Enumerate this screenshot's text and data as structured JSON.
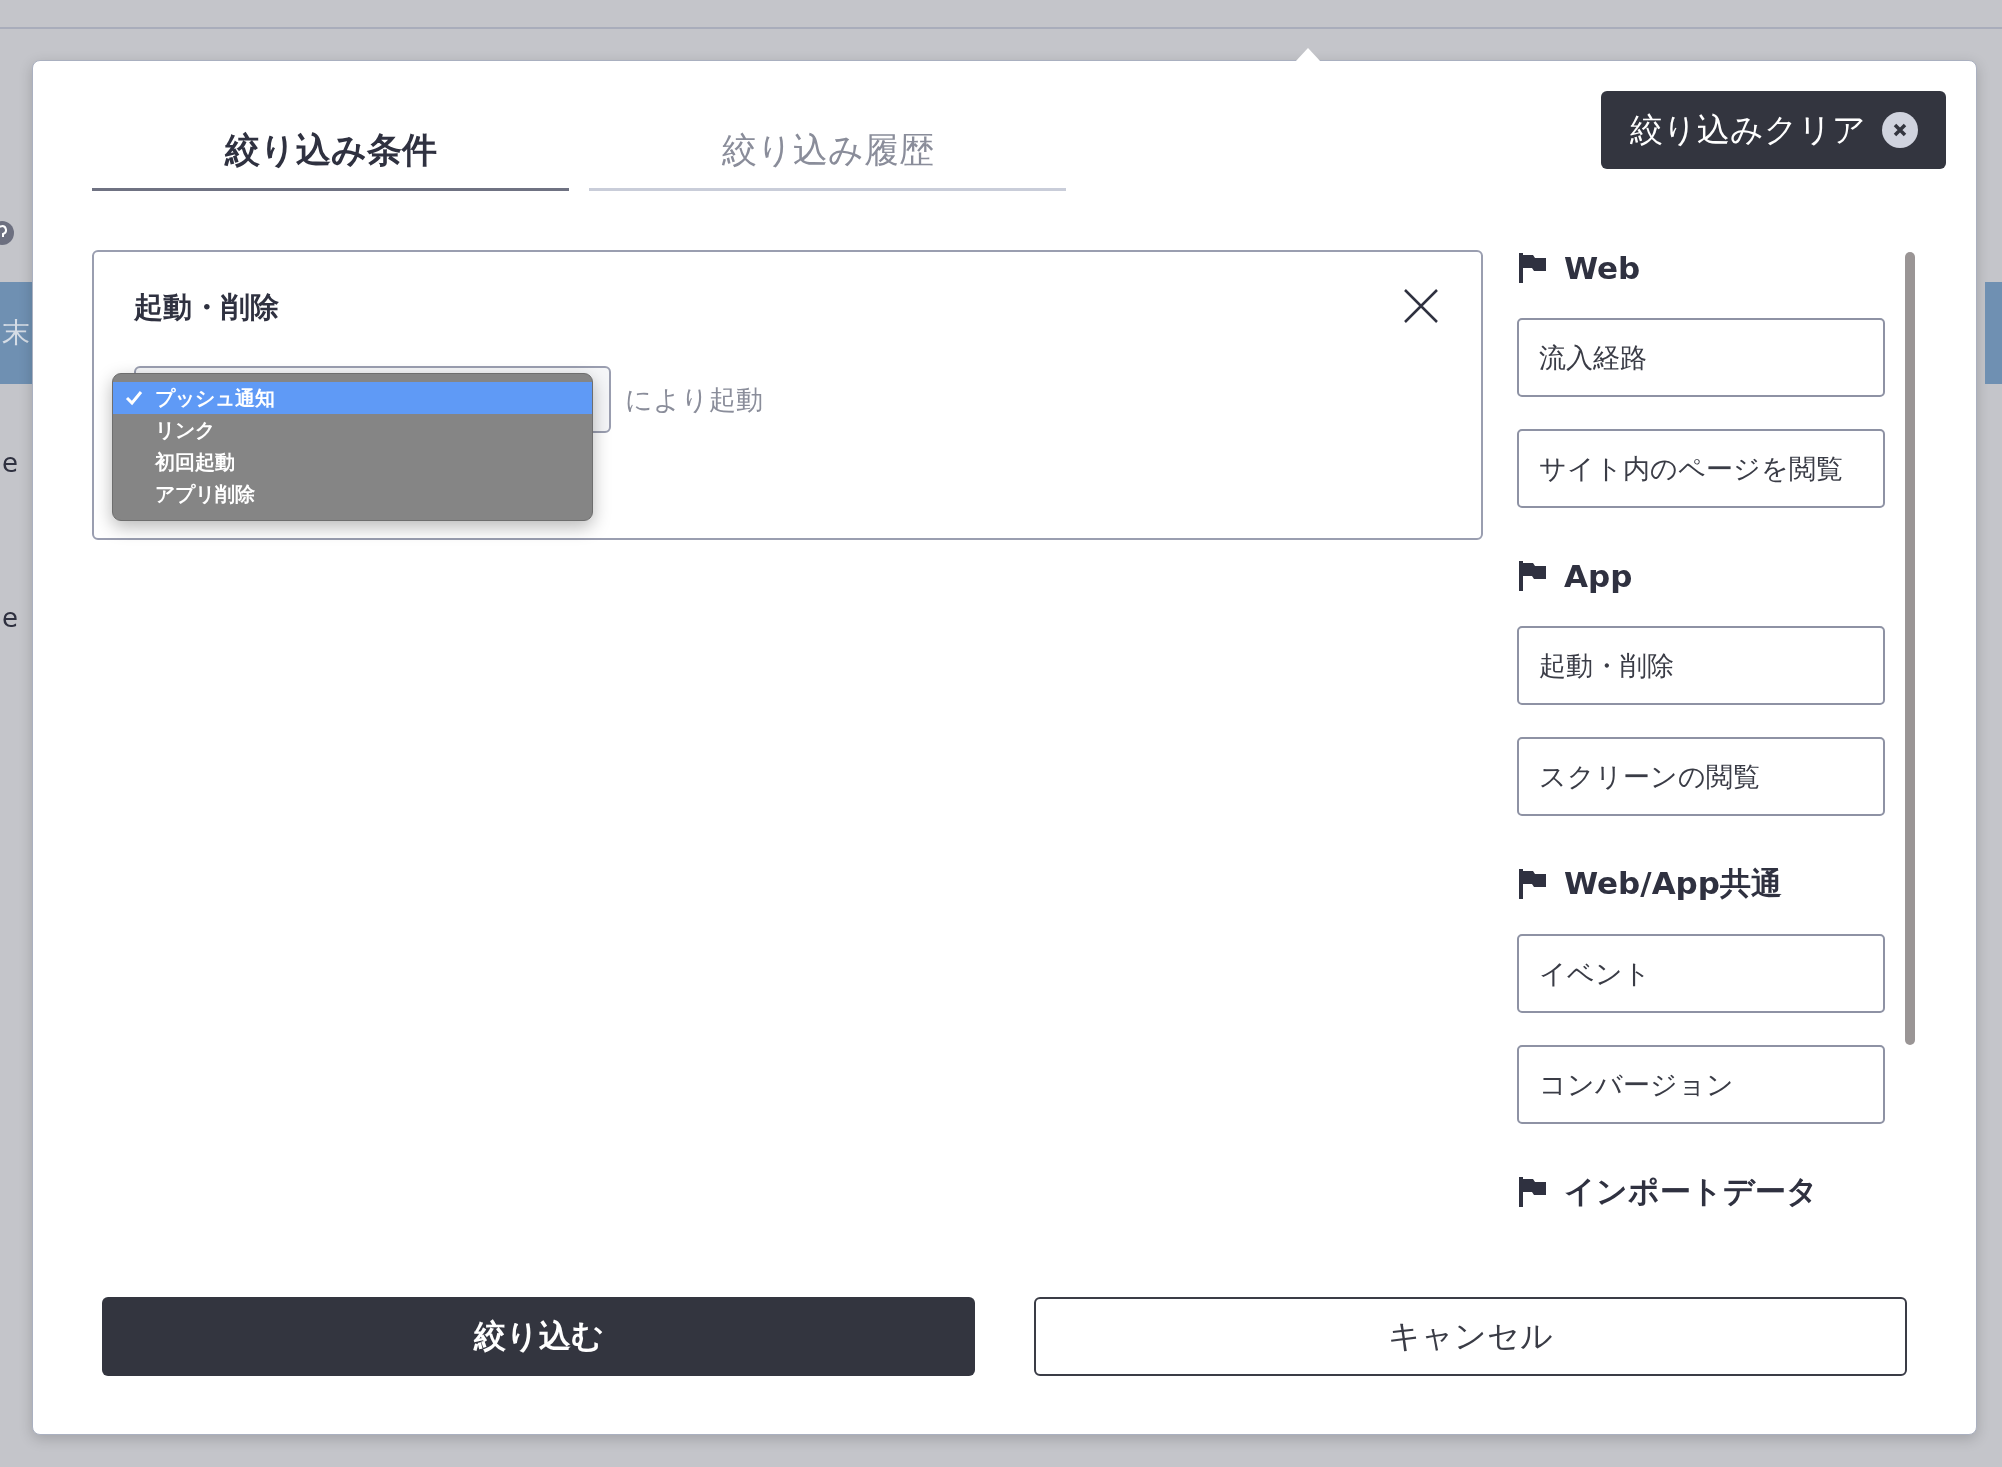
{
  "background": {
    "tag": "末",
    "rows": [
      "e",
      "e"
    ]
  },
  "tabs": [
    {
      "label": "絞り込み条件",
      "selected": true
    },
    {
      "label": "絞り込み履歴",
      "selected": false
    }
  ],
  "clear_button": {
    "label": "絞り込みクリア"
  },
  "condition": {
    "title": "起動・削除",
    "suffix": "により起動",
    "select": {
      "options": [
        {
          "label": "プッシュ通知",
          "selected": true
        },
        {
          "label": "リンク",
          "selected": false
        },
        {
          "label": "初回起動",
          "selected": false
        },
        {
          "label": "アプリ削除",
          "selected": false
        }
      ]
    }
  },
  "palette": {
    "sections": [
      {
        "title": "Web",
        "items": [
          "流入経路",
          "サイト内のページを閲覧"
        ]
      },
      {
        "title": "App",
        "items": [
          "起動・削除",
          "スクリーンの閲覧"
        ]
      },
      {
        "title": "Web/App共通",
        "items": [
          "イベント",
          "コンバージョン"
        ]
      },
      {
        "title": "インポートデータ"
      }
    ]
  },
  "footer": {
    "submit": "絞り込む",
    "cancel": "キャンセル"
  }
}
